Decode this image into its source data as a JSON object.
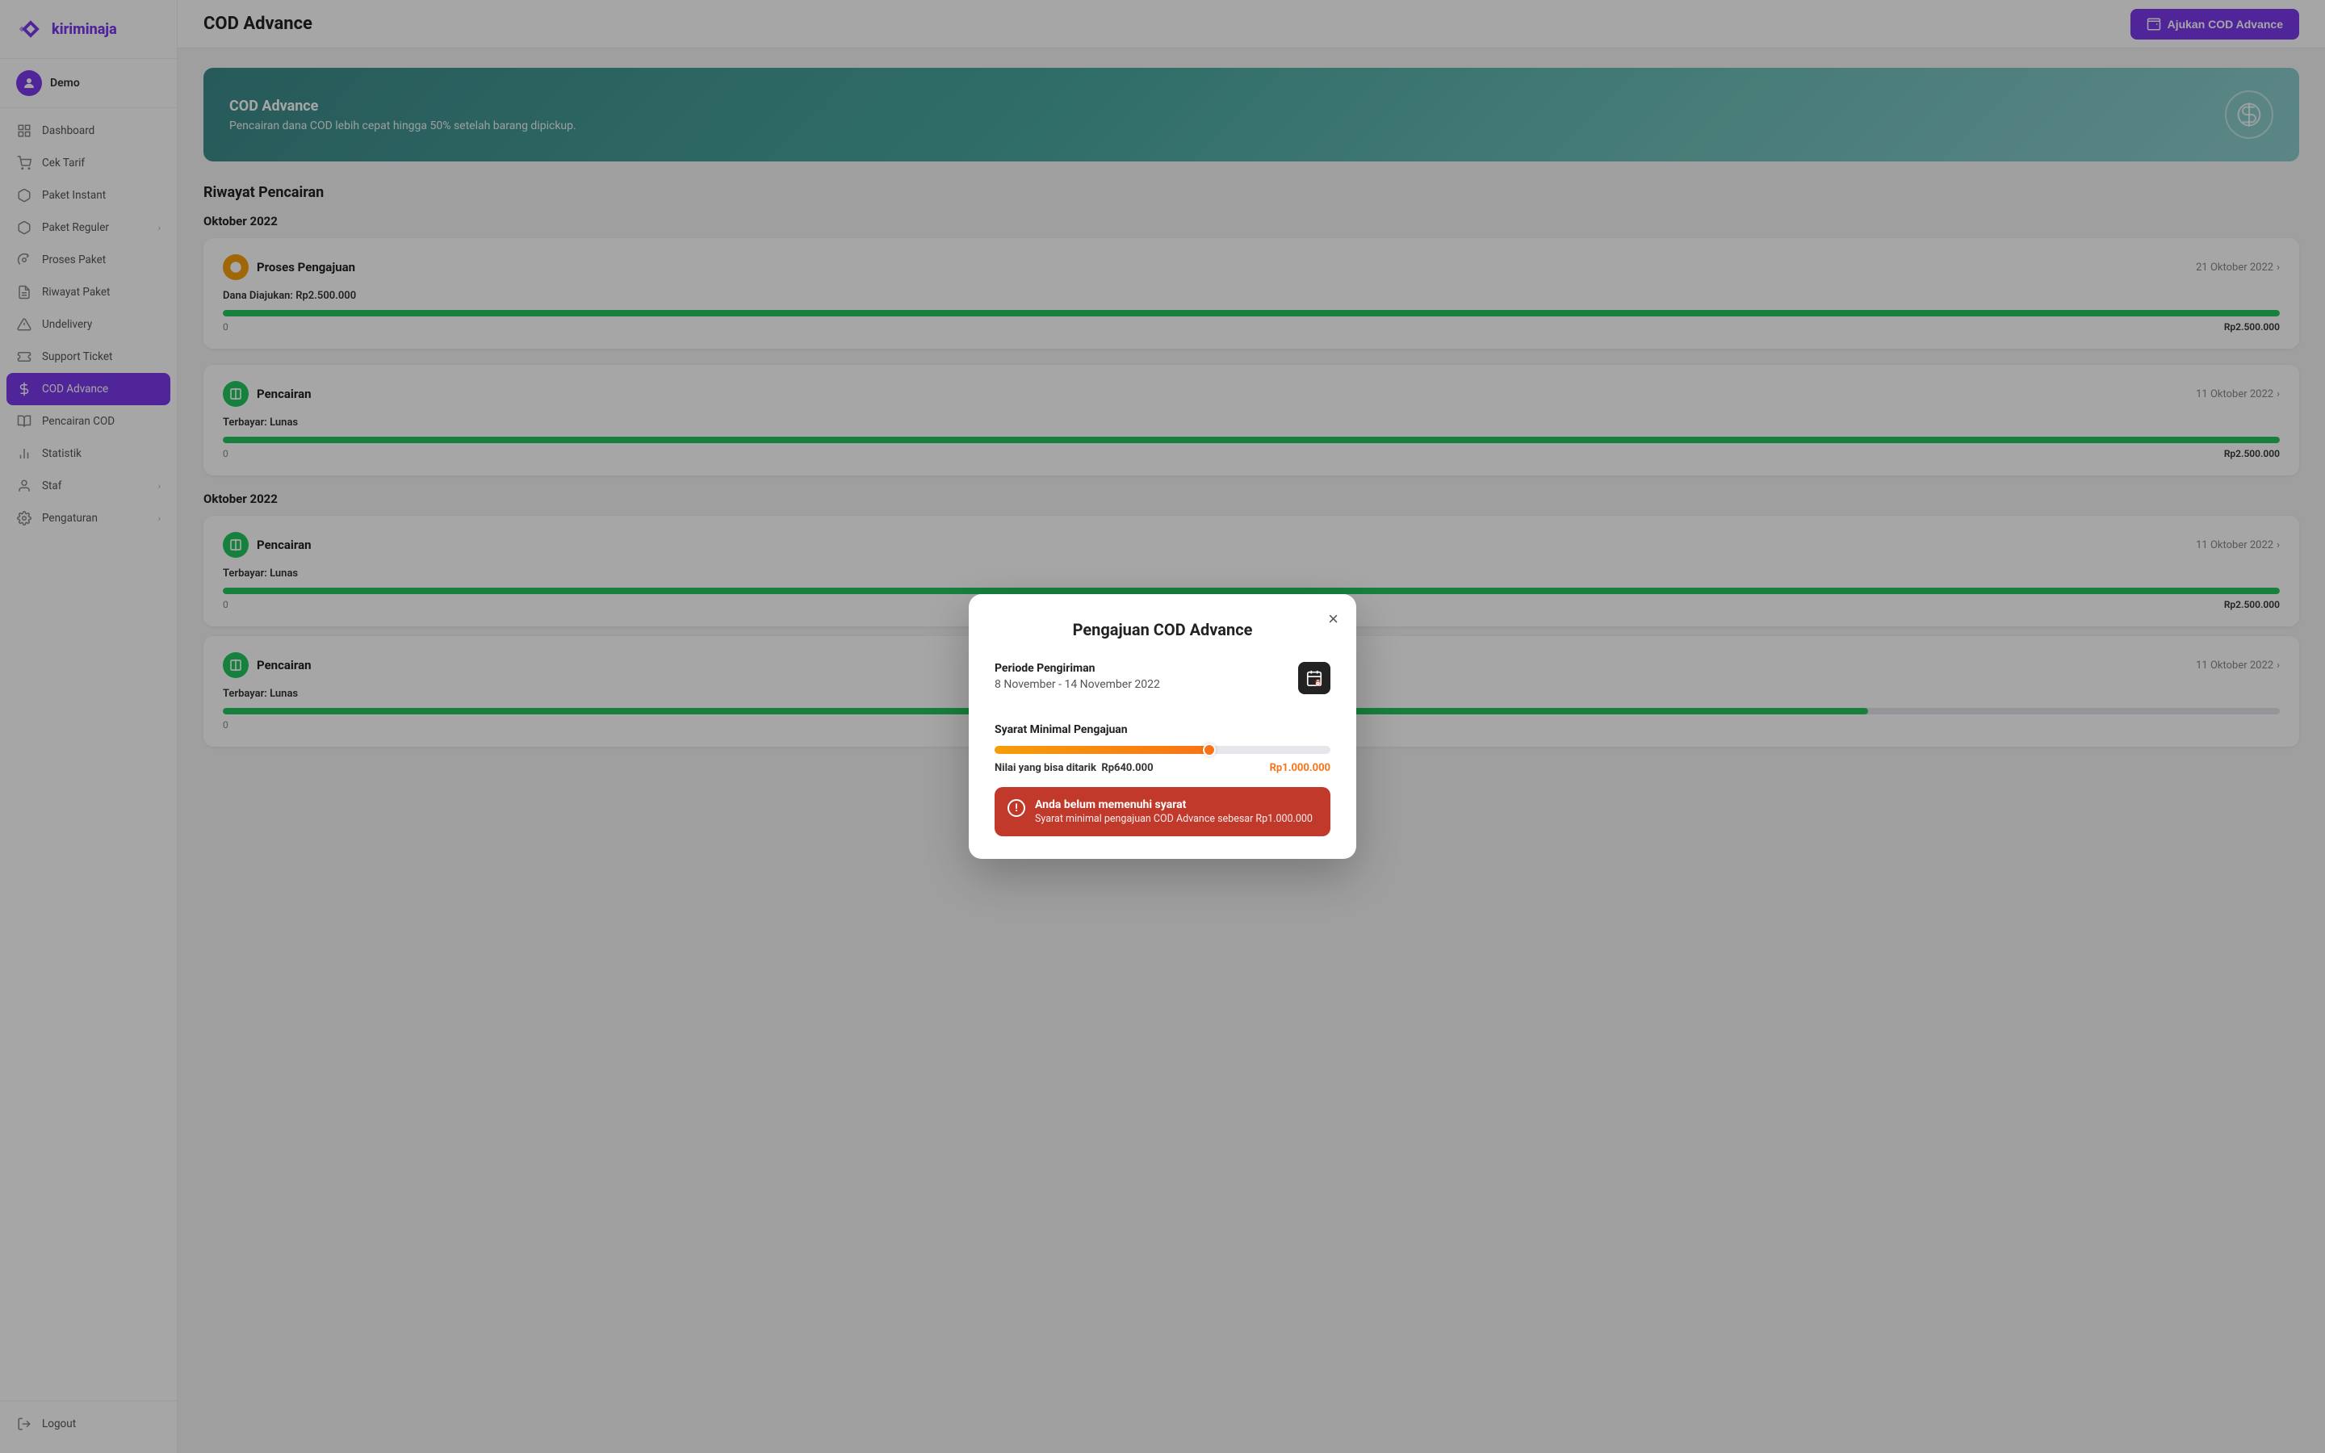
{
  "brand": {
    "name": "kiriminaja"
  },
  "user": {
    "name": "Demo"
  },
  "sidebar": {
    "items": [
      {
        "id": "dashboard",
        "label": "Dashboard",
        "icon": "⊞",
        "hasChevron": false
      },
      {
        "id": "cek-tarif",
        "label": "Cek Tarif",
        "icon": "🛒",
        "hasChevron": false
      },
      {
        "id": "paket-instant",
        "label": "Paket Instant",
        "icon": "📦",
        "hasChevron": false
      },
      {
        "id": "paket-reguler",
        "label": "Paket Reguler",
        "icon": "📦",
        "hasChevron": true
      },
      {
        "id": "proses-paket",
        "label": "Proses Paket",
        "icon": "⚙",
        "hasChevron": false
      },
      {
        "id": "riwayat-paket",
        "label": "Riwayat Paket",
        "icon": "📋",
        "hasChevron": false
      },
      {
        "id": "undelivery",
        "label": "Undelivery",
        "icon": "⚠",
        "hasChevron": false
      },
      {
        "id": "support-ticket",
        "label": "Support Ticket",
        "icon": "🎫",
        "hasChevron": false
      },
      {
        "id": "cod-advance",
        "label": "COD Advance",
        "icon": "💲",
        "hasChevron": false,
        "active": true
      },
      {
        "id": "pencairan-cod",
        "label": "Pencairan COD",
        "icon": "📖",
        "hasChevron": false
      },
      {
        "id": "statistik",
        "label": "Statistik",
        "icon": "📊",
        "hasChevron": false
      },
      {
        "id": "staf",
        "label": "Staf",
        "icon": "👤",
        "hasChevron": true
      },
      {
        "id": "pengaturan",
        "label": "Pengaturan",
        "icon": "⚙",
        "hasChevron": true
      }
    ],
    "logout": "Logout"
  },
  "topbar": {
    "title": "COD Advance",
    "button": "Ajukan COD Advance"
  },
  "banner": {
    "title": "COD Advance",
    "subtitle": "Pencairan dana COD lebih cepat hingga 50% setelah barang dipickup."
  },
  "history": {
    "section_title": "Riwayat Pencairan",
    "months": [
      {
        "label": "Oktober 2022",
        "cards": [
          {
            "status_type": "yellow",
            "status_label": "Proses Pengajuan",
            "sub_info_label": "Dana Diajukan:",
            "sub_info_value": "Rp2.500.000",
            "date": "21 Oktober 2022",
            "progress_pct": 100,
            "progress_start": "0",
            "progress_end": "Rp2.500.000"
          }
        ]
      },
      {
        "label": "",
        "cards": [
          {
            "status_type": "green",
            "status_label": "Pencairan",
            "sub_info_label": "Terbayar:",
            "sub_info_value": "Lunas",
            "date": "11 Oktober 2022",
            "progress_pct": 100,
            "progress_start": "0",
            "progress_end": "Rp2.500.000"
          }
        ]
      },
      {
        "label": "Oktober 2022",
        "cards": [
          {
            "status_type": "green",
            "status_label": "Pencairan",
            "sub_info_label": "Terbayar:",
            "sub_info_value": "Lunas",
            "date": "11 Oktober 2022",
            "progress_pct": 100,
            "progress_start": "0",
            "progress_end": "Rp2.500.000"
          },
          {
            "status_type": "green",
            "status_label": "Pencairan",
            "sub_info_label": "Terbayar:",
            "sub_info_value": "Lunas",
            "date": "11 Oktober 2022",
            "progress_pct": 80,
            "progress_start": "0",
            "progress_end": ""
          }
        ]
      }
    ]
  },
  "modal": {
    "title": "Pengajuan COD Advance",
    "close_label": "×",
    "period_label": "Periode Pengiriman",
    "period_value": "8 November - 14 November 2022",
    "syarat_label": "Syarat Minimal Pengajuan",
    "progress_pct": 64,
    "progress_current_label": "Nilai yang bisa ditarik",
    "progress_current_value": "Rp640.000",
    "progress_target_value": "Rp1.000.000",
    "alert_title": "Anda belum memenuhi syarat",
    "alert_subtitle": "Syarat minimal pengajuan COD Advance sebesar Rp1.000.000"
  }
}
